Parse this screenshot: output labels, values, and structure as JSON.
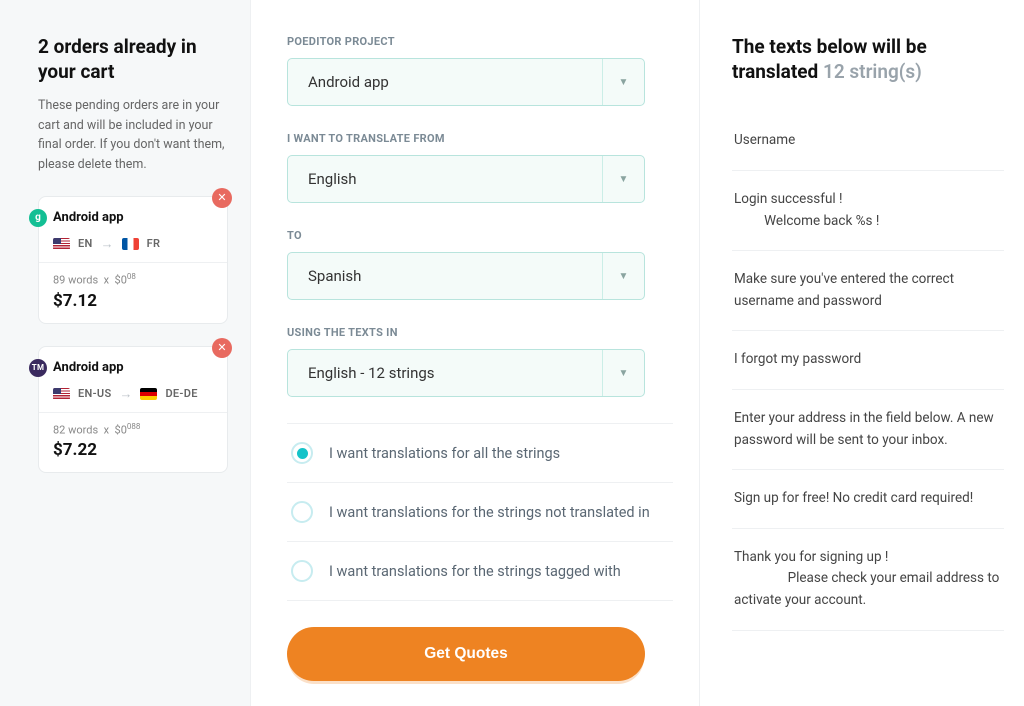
{
  "cart": {
    "heading": "2 orders already in your cart",
    "description": "These pending orders are in your cart and will be included in your final order. If you don't want them, please delete them.",
    "items": [
      {
        "badge": "g",
        "badge_color": "green",
        "title": "Android app",
        "from_flag": "us",
        "from_code": "EN",
        "to_flag": "fr",
        "to_code": "FR",
        "meta_words": "89 words",
        "meta_rate_base": "$0",
        "meta_rate_sup": "08",
        "price": "$7.12"
      },
      {
        "badge": "TM",
        "badge_color": "dark",
        "title": "Android app",
        "from_flag": "us",
        "from_code": "EN-US",
        "to_flag": "de",
        "to_code": "DE-DE",
        "meta_words": "82 words",
        "meta_rate_base": "$0",
        "meta_rate_sup": "088",
        "price": "$7.22"
      }
    ]
  },
  "form": {
    "labels": {
      "project": "POEDITOR PROJECT",
      "from": "I WANT TO TRANSLATE FROM",
      "to": "TO",
      "texts": "USING THE TEXTS IN"
    },
    "selects": {
      "project": "Android app",
      "from": "English",
      "to": "Spanish",
      "texts": "English - 12 strings"
    },
    "radios": [
      {
        "label": "I want translations for all the strings",
        "checked": true
      },
      {
        "label": "I want translations for the strings not translated in",
        "checked": false
      },
      {
        "label": "I want translations for the strings tagged with",
        "checked": false
      }
    ],
    "submit": "Get Quotes"
  },
  "preview": {
    "heading": "The texts below will be translated",
    "count_label": "12 string(s)",
    "strings": [
      "Username",
      "Login successful !\n         Welcome back %s !",
      "Make sure you've entered the correct username and password",
      "I forgot my password",
      "Enter your address in the field below. A new password will be sent to your inbox.",
      "Sign up for free! No credit card required!",
      "Thank you for signing up !\n                Please check your email address to activate your account."
    ]
  }
}
